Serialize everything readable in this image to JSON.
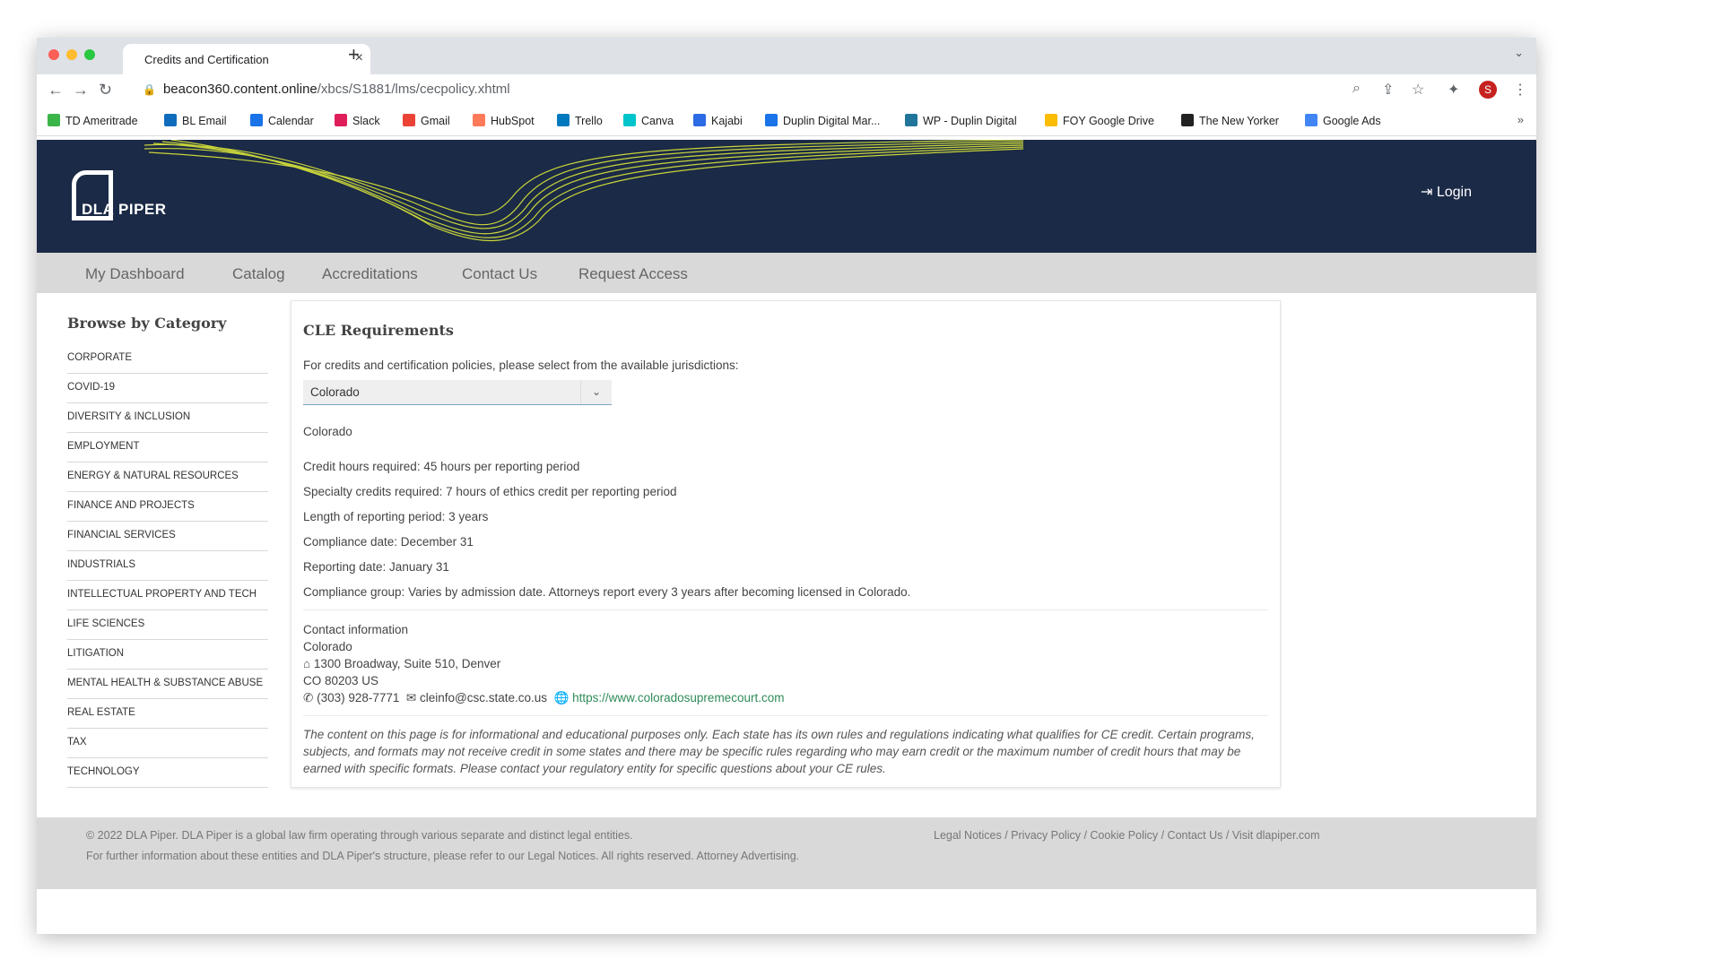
{
  "browser": {
    "tab_title": "Credits and Certification",
    "tab_close": "×",
    "new_tab": "+",
    "url_domain": "beacon360.content.online",
    "url_path": "/xbcs/S1881/lms/cecpolicy.xhtml",
    "avatar_initial": "S",
    "bookmarks": [
      {
        "label": "TD Ameritrade",
        "icon": "td-ameritrade-icon",
        "color": "#3bb44a"
      },
      {
        "label": "BL Email",
        "icon": "outlook-icon",
        "color": "#0f6cbd"
      },
      {
        "label": "Calendar",
        "icon": "calendar-icon",
        "color": "#1a73e8"
      },
      {
        "label": "Slack",
        "icon": "slack-icon",
        "color": "#e01e5a"
      },
      {
        "label": "Gmail",
        "icon": "gmail-icon",
        "color": "#ea4335"
      },
      {
        "label": "HubSpot",
        "icon": "hubspot-icon",
        "color": "#ff7a59"
      },
      {
        "label": "Trello",
        "icon": "trello-icon",
        "color": "#0079bf"
      },
      {
        "label": "Canva",
        "icon": "canva-icon",
        "color": "#00c4cc"
      },
      {
        "label": "Kajabi",
        "icon": "kajabi-icon",
        "color": "#2d6be4"
      },
      {
        "label": "Duplin Digital Mar...",
        "icon": "mail-icon",
        "color": "#1a73e8"
      },
      {
        "label": "WP - Duplin Digital",
        "icon": "wordpress-icon",
        "color": "#21759b"
      },
      {
        "label": "FOY Google Drive",
        "icon": "google-drive-icon",
        "color": "#fbbc04"
      },
      {
        "label": "The New Yorker",
        "icon": "new-yorker-icon",
        "color": "#222222"
      },
      {
        "label": "Google Ads",
        "icon": "google-ads-icon",
        "color": "#4285f4"
      }
    ],
    "bookmarks_more": "»"
  },
  "site": {
    "logo_text": "DLA PIPER",
    "login_label": "Login",
    "header_bg": "#1b2a46",
    "wave_color": "#c8d43a",
    "nav": [
      "My Dashboard",
      "Catalog",
      "Accreditations",
      "Contact Us",
      "Request Access"
    ]
  },
  "sidebar": {
    "title": "Browse by Category",
    "categories": [
      "CORPORATE",
      "COVID-19",
      "DIVERSITY & INCLUSION",
      "EMPLOYMENT",
      "ENERGY & NATURAL RESOURCES",
      "FINANCE AND PROJECTS",
      "FINANCIAL SERVICES",
      "INDUSTRIALS",
      "INTELLECTUAL PROPERTY AND TECH",
      "LIFE SCIENCES",
      "LITIGATION",
      "MENTAL HEALTH & SUBSTANCE ABUSE",
      "REAL ESTATE",
      "TAX",
      "TECHNOLOGY"
    ]
  },
  "content": {
    "title": "CLE Requirements",
    "prompt": "For credits and certification policies, please select from the available jurisdictions:",
    "selected_jurisdiction": "Colorado",
    "heading": "Colorado",
    "details": [
      "Credit hours required: 45 hours per reporting period",
      "Specialty credits required:  7 hours of ethics credit per reporting period",
      "Length of reporting period: 3 years",
      "Compliance date: December 31",
      "Reporting date: January 31",
      "Compliance group: Varies by admission date. Attorneys report every 3 years after becoming licensed in Colorado."
    ],
    "contact": {
      "label": "Contact information",
      "name": "Colorado",
      "address1": "1300 Broadway, Suite 510, Denver",
      "address2": "CO 80203 US",
      "phone": "(303) 928-7771",
      "email": "cleinfo@csc.state.co.us",
      "website": "https://www.coloradosupremecourt.com"
    },
    "disclaimer": "The content on this page is for informational and educational purposes only. Each state has its own rules and regulations indicating what qualifies for CE credit. Certain programs, subjects, and formats may not receive credit in some states and there may be specific rules regarding who may earn credit or the maximum number of credit hours that may be earned with specific formats. Please contact your regulatory entity for specific questions about your CE rules."
  },
  "footer": {
    "copyright": "© 2022 DLA Piper. DLA Piper is a global law firm operating through various separate and distinct legal entities.",
    "further": "For further information about these entities and DLA Piper's structure, please refer to our Legal Notices. All rights reserved. Attorney Advertising.",
    "links": [
      "Legal Notices",
      "Privacy Policy",
      "Cookie Policy",
      "Contact Us",
      "Visit dlapiper.com"
    ]
  }
}
